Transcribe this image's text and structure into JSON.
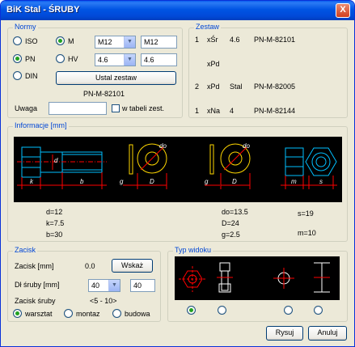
{
  "window": {
    "title": "BiK Stal - ŚRUBY",
    "close": "X"
  },
  "normy": {
    "legend": "Normy",
    "options": [
      "ISO",
      "PN",
      "DIN"
    ],
    "selected_norm": "PN",
    "class_options": [
      "M",
      "HV"
    ],
    "selected_class": "M",
    "m_select": "M12",
    "m_input": "M12",
    "hv_select": "4.6",
    "hv_input": "4.6",
    "set_button": "Ustal zestaw",
    "norm_code": "PN-M-82101",
    "uwaga_label": "Uwaga",
    "uwaga_value": "",
    "table_check_label": "w tabeli zest."
  },
  "zestaw": {
    "legend": "Zestaw",
    "rows": [
      {
        "num": "1",
        "name": "xŚr",
        "grade": "4.6",
        "code": "PN-M-82101"
      },
      {
        "num": "",
        "name": "xPd",
        "grade": "",
        "code": ""
      },
      {
        "num": "2",
        "name": "xPd",
        "grade": "Stal",
        "code": "PN-M-82005"
      },
      {
        "num": "1",
        "name": "xNa",
        "grade": "4",
        "code": "PN-M-82144"
      }
    ]
  },
  "informacje": {
    "legend": "Informacje [mm]",
    "labels": [
      "d",
      "k",
      "b",
      "g",
      "D",
      "do",
      "m",
      "s"
    ],
    "col1": [
      "d=12",
      "k=7.5",
      "b=30"
    ],
    "col2": [
      "do=13.5",
      "D=24",
      "g=2.5"
    ],
    "col3": [
      "s=19",
      "m=10"
    ],
    "colors": {
      "outline": "#00bfff",
      "dimension": "#ff0000",
      "washer": "#ffd700",
      "text": "#ffffff"
    }
  },
  "zacisk": {
    "legend": "Zacisk",
    "zacisk_label": "Zacisk [mm]",
    "zacisk_value": "0.0",
    "wskaz_button": "Wskaż",
    "dl_label": "Dł śruby [mm]",
    "dl_select": "40",
    "dl_input": "40",
    "range_label": "Zacisk śruby",
    "range_value": "<5 - 10>",
    "modes": [
      "warsztat",
      "montaz",
      "budowa"
    ],
    "selected_mode": "warsztat"
  },
  "typ": {
    "legend": "Typ widoku",
    "selected_index": 0
  },
  "footer": {
    "draw_button": "Rysuj",
    "cancel_button": "Anuluj"
  }
}
